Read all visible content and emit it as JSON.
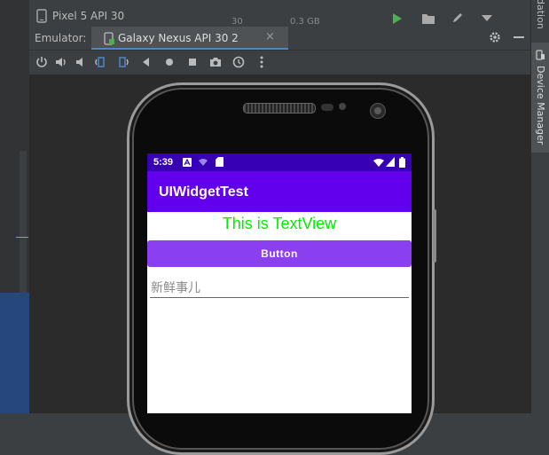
{
  "top_bar": {
    "device_selector": "Pixel 5 API 30",
    "ghost_values": [
      "30",
      "0.3 GB"
    ]
  },
  "right_toolbar": {
    "top_label_fragment": "dation",
    "device_manager_label": "Device Manager"
  },
  "emulator": {
    "title": "Emulator:",
    "tab_label": "Galaxy Nexus API 30 2",
    "tab_close": "×"
  },
  "emulator_toolbar": {
    "icons": [
      "power-icon",
      "volume-up-icon",
      "volume-down-icon",
      "rotate-left-icon",
      "rotate-right-icon",
      "back-icon",
      "home-icon",
      "overview-icon",
      "screenshot-icon",
      "snapshot-icon",
      "more-icon"
    ]
  },
  "app": {
    "status_time": "5:39",
    "title": "UIWidgetTest",
    "textview": "This is TextView",
    "button_label": "Button",
    "edit_hint": "新鲜事儿"
  },
  "colors": {
    "status_bar": "#3700b3",
    "action_bar": "#6200ee",
    "button": "#8a3ff0",
    "textview": "#00ee00",
    "run_green": "#4caf50"
  }
}
